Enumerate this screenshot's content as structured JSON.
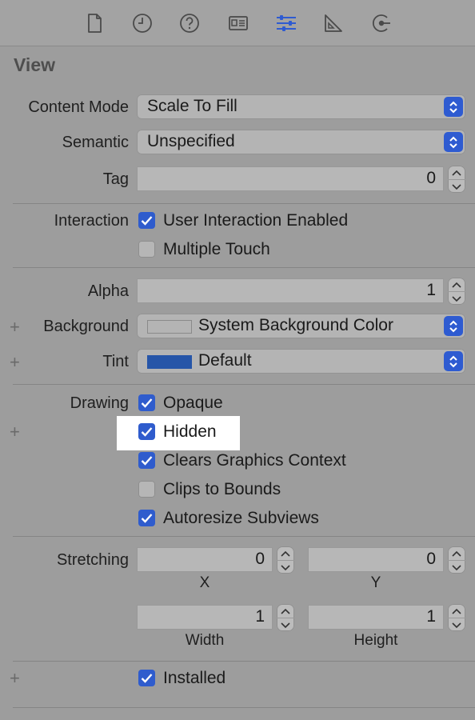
{
  "toolbar": {
    "icons": [
      "file-icon",
      "history-icon",
      "help-icon",
      "identity-icon",
      "attributes-icon",
      "size-icon",
      "connections-icon"
    ],
    "active_icon": "attributes-icon",
    "accent": "#2e5bd1"
  },
  "section": {
    "title": "View"
  },
  "content_mode": {
    "label": "Content Mode",
    "value": "Scale To Fill"
  },
  "semantic": {
    "label": "Semantic",
    "value": "Unspecified"
  },
  "tag": {
    "label": "Tag",
    "value": "0"
  },
  "interaction": {
    "label": "Interaction",
    "user_interaction": {
      "label": "User Interaction Enabled",
      "checked": true
    },
    "multiple_touch": {
      "label": "Multiple Touch",
      "checked": false
    }
  },
  "alpha": {
    "label": "Alpha",
    "value": "1"
  },
  "background": {
    "label": "Background",
    "value": "System Background Color",
    "swatch": "#b4b4b4"
  },
  "tint": {
    "label": "Tint",
    "value": "Default",
    "swatch": "#2655a8"
  },
  "drawing": {
    "label": "Drawing",
    "opaque": {
      "label": "Opaque",
      "checked": true
    },
    "hidden": {
      "label": "Hidden",
      "checked": true
    },
    "clears_graphics": {
      "label": "Clears Graphics Context",
      "checked": true
    },
    "clips_to_bounds": {
      "label": "Clips to Bounds",
      "checked": false
    },
    "autoresize": {
      "label": "Autoresize Subviews",
      "checked": true
    }
  },
  "stretching": {
    "label": "Stretching",
    "x": {
      "value": "0",
      "label": "X"
    },
    "y": {
      "value": "0",
      "label": "Y"
    },
    "width": {
      "value": "1",
      "label": "Width"
    },
    "height": {
      "value": "1",
      "label": "Height"
    }
  },
  "installed": {
    "label": "Installed",
    "checked": true
  },
  "plus_glyph": "+"
}
